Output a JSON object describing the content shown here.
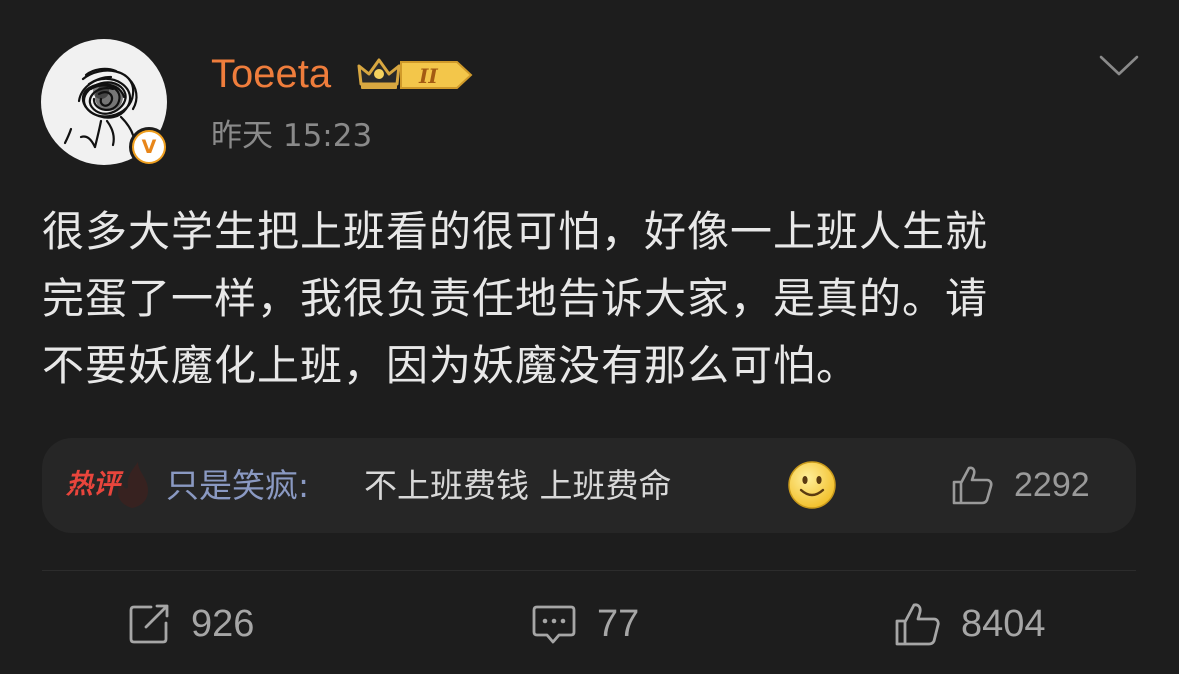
{
  "post": {
    "author": {
      "name": "Toeeta",
      "level_badge": "II",
      "verified_badge": "V"
    },
    "timestamp": "昨天 15:23",
    "text_lines": [
      "很多大学生把上班看的很可怕，好像一上班人生就",
      "完蛋了一样，我很负责任地告诉大家，是真的。请",
      "不要妖魔化上班，因为妖魔没有那么可怕。"
    ],
    "hot_comment": {
      "tag": "热评",
      "author": "只是笑疯:",
      "text": "不上班费钱 上班费命",
      "emoji": "smiley-face-icon",
      "likes": "2292"
    },
    "actions": {
      "reposts": "926",
      "comments": "77",
      "likes": "8404"
    }
  },
  "colors": {
    "background": "#1d1d1d",
    "username": "#ef7d3c",
    "comment_author": "#8a99c2",
    "hot_tag": "#e8453c",
    "muted": "#8a8a8a",
    "verified": "#f0a020"
  },
  "icons": {
    "menu": "chevron-down-icon",
    "repost": "repost-icon",
    "comment": "comment-icon",
    "like": "thumbs-up-icon",
    "crown": "crown-icon"
  }
}
